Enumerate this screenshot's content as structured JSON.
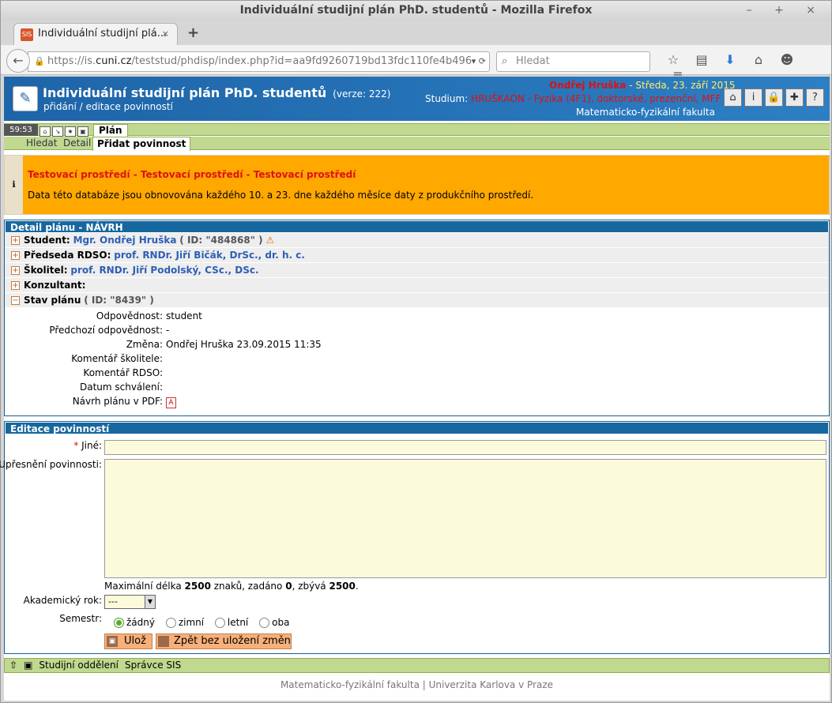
{
  "browser": {
    "window_title": "Individuální studijní plán PhD. studentů - Mozilla Firefox",
    "window_controls": "– + ×",
    "tab_title": "Individuální studijní plá...",
    "tab_favicon": "SIS",
    "tab_close": "×",
    "newtab": "+",
    "url_prefix": "https://is.",
    "url_host": "cuni.cz",
    "url_rest": "/teststud/phdisp/index.php?id=aa9fd9260719bd13fdc110fe4b496ce",
    "search_placeholder": "Hledat"
  },
  "header": {
    "title": "Individuální studijní plán PhD. studentů",
    "version": "(verze: 222)",
    "subtitle": "přidání / editace povinností",
    "user_name": "Ondřej Hruška",
    "date": " -  Středa, 23. září 2015",
    "study_label": "Studium:",
    "study_value": "HRUŠKAON - Fyzika (4F1), doktorské, prezenční, MFF",
    "faculty": "Matematicko-fyzikální fakulta"
  },
  "menu": {
    "timer": "59:53",
    "plan_tab": "Plán",
    "subtabs": [
      "Hledat",
      "Detail",
      "Přidat povinnost"
    ]
  },
  "warning": {
    "title": "Testovací prostředí - Testovací prostředí - Testovací prostředí",
    "body": "Data této databáze jsou obnovována každého 10. a 23. dne každého měsíce daty z produkčního prostředí."
  },
  "detail": {
    "title": "Detail plánu - NÁVRH",
    "student_label": "Student:",
    "student_name": "Mgr. Ondřej Hruška",
    "student_id": "( ID: \"484868\" )",
    "chair_label": "Předseda RDSO:",
    "chair_name": "prof. RNDr. Jiří Bičák, DrSc., dr. h. c.",
    "supervisor_label": "Školitel:",
    "supervisor_name": "prof. RNDr. Jiří Podolský, CSc., DSc.",
    "consultant_label": "Konzultant:",
    "state_label": "Stav plánu",
    "state_id": "( ID: \"8439\" )",
    "fields": [
      {
        "k": "Odpovědnost:",
        "v": "student"
      },
      {
        "k": "Předchozí odpovědnost:",
        "v": "-"
      },
      {
        "k": "Změna:",
        "v": "Ondřej Hruška 23.09.2015 11:35"
      },
      {
        "k": "Komentář školitele:",
        "v": ""
      },
      {
        "k": "Komentář RDSO:",
        "v": ""
      },
      {
        "k": "Datum schválení:",
        "v": ""
      },
      {
        "k": "Návrh plánu v PDF:",
        "v": ""
      }
    ]
  },
  "edit": {
    "title": "Editace povinností",
    "other_req": "*",
    "other_label": " Jiné:",
    "spec_label": "Upřesnění povinnosti:",
    "maxlen_pre": "Maximální délka ",
    "maxlen": "2500",
    "maxlen_mid": " znaků, zadáno ",
    "entered": "0",
    "maxlen_mid2": ", zbývá ",
    "remaining": "2500",
    "maxlen_end": ".",
    "year_label": "Akademický rok:",
    "year_value": "---",
    "sem_label": "Semestr:",
    "sem_options": [
      "žádný",
      "zimní",
      "letní",
      "oba"
    ],
    "save_btn": "Ulož",
    "back_btn": "Zpět bez uložení změn"
  },
  "footer": {
    "links": [
      "Studijní oddělení",
      "Správce SIS"
    ],
    "copyright": "Matematicko-fyzikální fakulta | Univerzita Karlova v Praze"
  }
}
